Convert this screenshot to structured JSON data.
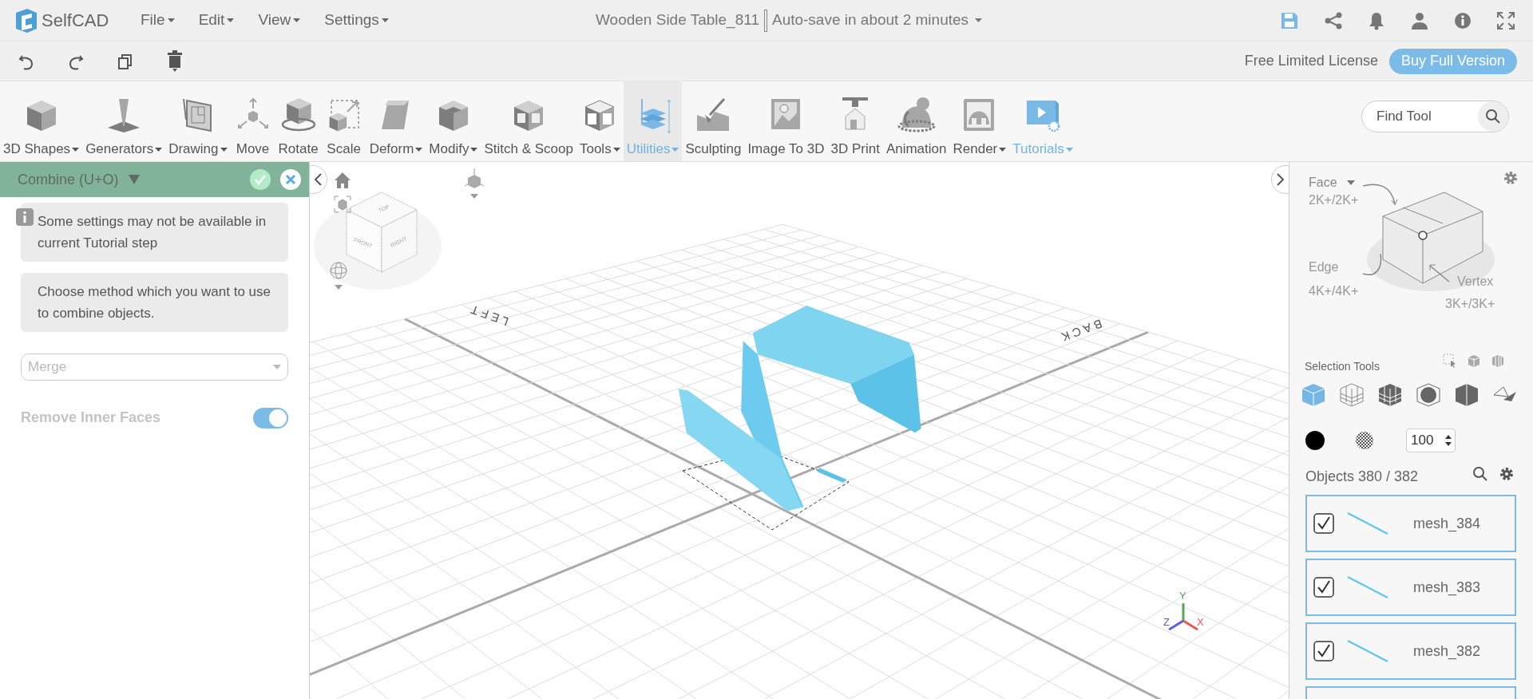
{
  "app": {
    "logo": "SelfCAD",
    "menus": [
      {
        "label": "File"
      },
      {
        "label": "Edit"
      },
      {
        "label": "View"
      },
      {
        "label": "Settings"
      }
    ],
    "document_title": "Wooden Side Table_811",
    "autosave": "Auto-save in about 2 minutes"
  },
  "license": {
    "text": "Free Limited License",
    "button": "Buy Full Version"
  },
  "tools": [
    {
      "label": "3D Shapes",
      "dropdown": true,
      "selected": false,
      "accent": false
    },
    {
      "label": "Generators",
      "dropdown": true,
      "selected": false,
      "accent": false
    },
    {
      "label": "Drawing",
      "dropdown": true,
      "selected": false,
      "accent": false
    },
    {
      "label": "Move",
      "dropdown": false,
      "selected": false,
      "accent": false
    },
    {
      "label": "Rotate",
      "dropdown": false,
      "selected": false,
      "accent": false
    },
    {
      "label": "Scale",
      "dropdown": false,
      "selected": false,
      "accent": false
    },
    {
      "label": "Deform",
      "dropdown": true,
      "selected": false,
      "accent": false
    },
    {
      "label": "Modify",
      "dropdown": true,
      "selected": false,
      "accent": false
    },
    {
      "label": "Stitch & Scoop",
      "dropdown": false,
      "selected": false,
      "accent": false
    },
    {
      "label": "Tools",
      "dropdown": true,
      "selected": false,
      "accent": false
    },
    {
      "label": "Utilities",
      "dropdown": true,
      "selected": true,
      "accent": true
    },
    {
      "label": "Sculpting",
      "dropdown": false,
      "selected": false,
      "accent": false
    },
    {
      "label": "Image To 3D",
      "dropdown": false,
      "selected": false,
      "accent": false
    },
    {
      "label": "3D Print",
      "dropdown": false,
      "selected": false,
      "accent": false
    },
    {
      "label": "Animation",
      "dropdown": false,
      "selected": false,
      "accent": false
    },
    {
      "label": "Render",
      "dropdown": true,
      "selected": false,
      "accent": false
    },
    {
      "label": "Tutorials",
      "dropdown": true,
      "selected": false,
      "accent": true
    }
  ],
  "find_tool": {
    "placeholder": "Find Tool"
  },
  "panel": {
    "title": "Combine (U+O)",
    "notes": [
      "Some settings may not be available in current Tutorial step",
      "Choose method which you want to use to combine objects."
    ],
    "method": {
      "value": "Merge",
      "disabled": true
    },
    "toggle": {
      "label": "Remove Inner Faces",
      "on": true,
      "disabled": true
    }
  },
  "viewport": {
    "view_cube": [
      "TOP",
      "FRONT",
      "RIGHT"
    ],
    "ground_labels": [
      "LEFT",
      "BACK"
    ],
    "axes": [
      "X",
      "Y",
      "Z"
    ]
  },
  "selection": {
    "face": {
      "label": "Face",
      "count": "2K+/2K+"
    },
    "edge": {
      "label": "Edge",
      "count": "4K+/4K+"
    },
    "vertex": {
      "label": "Vertex",
      "count": "3K+/3K+"
    },
    "tools_label": "Selection Tools",
    "modes": [
      {
        "selected": true
      },
      {
        "selected": false
      },
      {
        "selected": false
      },
      {
        "selected": false
      },
      {
        "selected": false
      },
      {
        "selected": false
      }
    ],
    "opacity": "100"
  },
  "objects": {
    "header": "Objects 380 / 382",
    "items": [
      {
        "name": "mesh_384",
        "checked": true
      },
      {
        "name": "mesh_383",
        "checked": true
      },
      {
        "name": "mesh_382",
        "checked": true
      }
    ]
  }
}
